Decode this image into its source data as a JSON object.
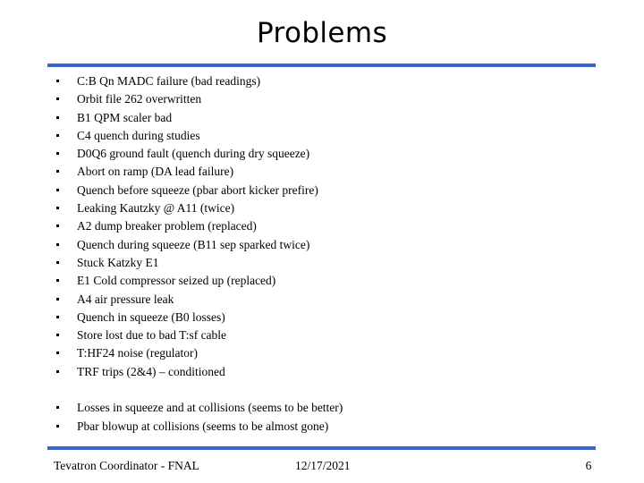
{
  "slide": {
    "title": "Problems",
    "accent_color": "#3C63D2",
    "text_color": "#000000",
    "background_color": "#FFFFFF"
  },
  "body": {
    "bullets": [
      "C:B Qn MADC failure (bad readings)",
      "Orbit file 262 overwritten",
      "B1 QPM scaler bad",
      "C4 quench during studies",
      "D0Q6 ground fault (quench during dry squeeze)",
      "Abort on ramp (DA lead failure)",
      "Quench before squeeze (pbar abort kicker prefire)",
      "Leaking Kautzky @ A11 (twice)",
      "A2 dump breaker problem (replaced)",
      "Quench during squeeze (B11 sep sparked twice)",
      "Stuck Katzky E1",
      "E1 Cold compressor seized up (replaced)",
      "A4 air pressure leak",
      "Quench in squeeze (B0 losses)",
      "Store lost due to bad T:sf cable",
      "T:HF24 noise (regulator)",
      "TRF trips (2&4) – conditioned"
    ],
    "bullets_second_group": [
      "Losses in squeeze and at collisions (seems to be better)",
      "Pbar blowup at collisions (seems to be almost gone)"
    ]
  },
  "footer": {
    "left": "Tevatron Coordinator - FNAL",
    "date": "12/17/2021",
    "page_number": "6"
  }
}
